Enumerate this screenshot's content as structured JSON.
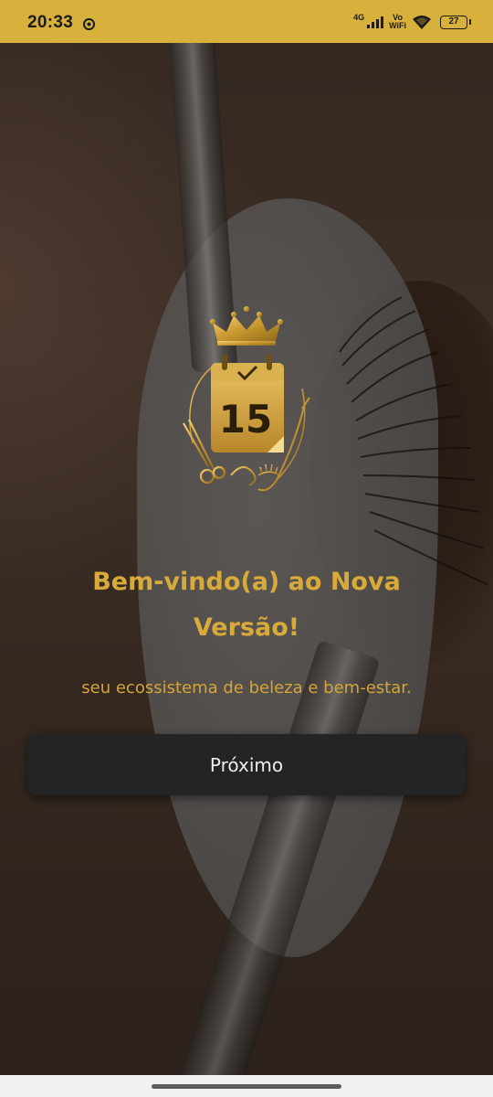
{
  "status_bar": {
    "time": "20:33",
    "network": "4G",
    "vowifi_top": "Vo",
    "vowifi_bottom": "WiFi",
    "battery": "27",
    "background_color": "#d7b13b"
  },
  "welcome": {
    "title": "Bem-vindo(a) ao Nova Versão!",
    "subtitle": "seu ecossistema de beleza e bem-estar."
  },
  "logo": {
    "calendar_day": "15",
    "icons": [
      "crown-icon",
      "calendar-icon",
      "checkmark-icon",
      "scissors-icon",
      "eyelash-icon",
      "hair-tool-icon"
    ]
  },
  "actions": {
    "next_label": "Próximo"
  },
  "colors": {
    "accent_gold": "#d8aa3a",
    "button_bg": "#242424",
    "button_text": "#ececec"
  }
}
